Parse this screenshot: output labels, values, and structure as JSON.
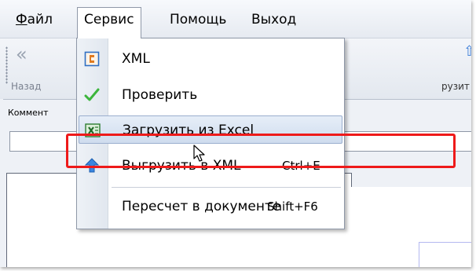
{
  "menubar": {
    "items": [
      {
        "label": "Файл",
        "underline": "Ф",
        "rest": "айл"
      },
      {
        "label": "Сервис"
      },
      {
        "label": "Помощь"
      },
      {
        "label": "Выход"
      }
    ]
  },
  "toolbar": {
    "back_label": "Назад",
    "back_icon": "double-chevron-left-icon",
    "export_label_partial": "рузит",
    "export_icon": "export-icon"
  },
  "comment": {
    "label_partial": "Коммент",
    "value": ""
  },
  "dropdown": {
    "items": [
      {
        "label": "XML",
        "shortcut": "",
        "icon": "xml-icon"
      },
      {
        "label": "Проверить",
        "shortcut": "",
        "icon": "checkmark-icon"
      },
      {
        "label": "Загрузить из Excel",
        "shortcut": "",
        "icon": "excel-icon",
        "highlighted": true
      },
      {
        "label": "Выгрузить в XML",
        "shortcut": "Ctrl+E",
        "icon": "upload-arrow-icon"
      },
      {
        "label": "Пересчет в документе",
        "shortcut": "Shift+F6",
        "icon": ""
      }
    ]
  },
  "colors": {
    "highlight_box": "#ee1a1a",
    "menu_hover": "#cfdcee",
    "check_green": "#3cb53c",
    "xml_orange": "#e07a1f"
  }
}
